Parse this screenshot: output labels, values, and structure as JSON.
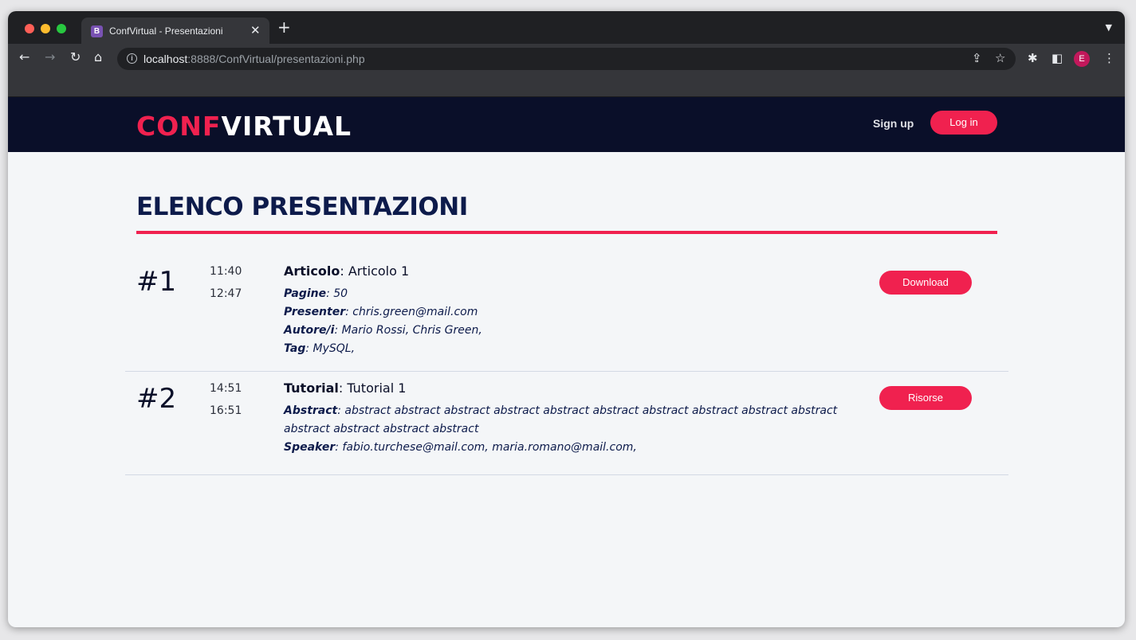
{
  "browser": {
    "tab_title": "ConfVirtual - Presentazioni",
    "tab_favicon": "B",
    "url_host": "localhost",
    "url_path": ":8888/ConfVirtual/presentazioni.php",
    "profile_initial": "E"
  },
  "header": {
    "logo_part1": "CONF",
    "logo_part2": "VIRTUAL",
    "signup": "Sign up",
    "login": "Log in"
  },
  "page": {
    "title": "ELENCO PRESENTAZIONI"
  },
  "presentations": [
    {
      "number": "#1",
      "start": "11:40",
      "end": "12:47",
      "type": "Articolo",
      "name": ": Articolo 1",
      "fields": [
        {
          "label": "Pagine",
          "value": ": 50"
        },
        {
          "label": "Presenter",
          "value": ": chris.green@mail.com"
        },
        {
          "label": "Autore/i",
          "value": ": Mario Rossi, Chris Green,"
        },
        {
          "label": "Tag",
          "value": ": MySQL,"
        }
      ],
      "button": "Download"
    },
    {
      "number": "#2",
      "start": "14:51",
      "end": "16:51",
      "type": "Tutorial",
      "name": ": Tutorial 1",
      "fields": [
        {
          "label": "Abstract",
          "value": ": abstract abstract abstract abstract abstract abstract abstract abstract abstract abstract abstract abstract abstract abstract"
        },
        {
          "label": "Speaker",
          "value": ": fabio.turchese@mail.com, maria.romano@mail.com,"
        }
      ],
      "button": "Risorse"
    }
  ],
  "colors": {
    "accent": "#f0214f",
    "navy": "#0a0f29",
    "title": "#0d1b4b"
  }
}
